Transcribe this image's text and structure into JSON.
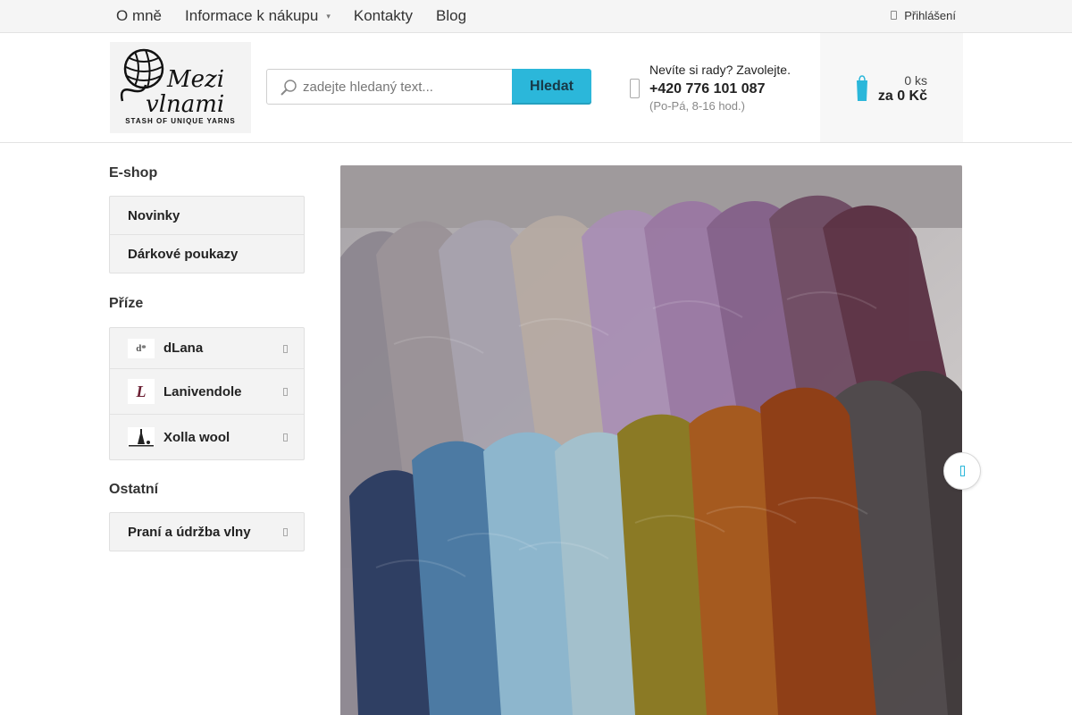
{
  "topnav": {
    "items": [
      {
        "label": "O mně"
      },
      {
        "label": "Informace k nákupu",
        "has_dropdown": true
      },
      {
        "label": "Kontakty"
      },
      {
        "label": "Blog"
      }
    ],
    "login_label": "Přihlášení"
  },
  "header": {
    "logo": {
      "text": "Mezi vlnami",
      "tagline": "STASH OF UNIQUE YARNS",
      "icon": "yarn-ball-logo"
    },
    "search": {
      "placeholder": "zadejte hledaný text...",
      "value": "",
      "button_label": "Hledat"
    },
    "contact": {
      "question": "Nevíte si rady? Zavolejte.",
      "phone": "+420 776 101 087",
      "hours": "(Po-Pá, 8-16 hod.)"
    },
    "cart": {
      "quantity": "0 ks",
      "total": "za 0 Kč"
    }
  },
  "sidebar": {
    "sections": [
      {
        "title": "E-shop",
        "items": [
          {
            "label": "Novinky"
          },
          {
            "label": "Dárkové poukazy"
          }
        ]
      },
      {
        "title": "Příze",
        "items": [
          {
            "label": "dLana",
            "thumb_text": "d*"
          },
          {
            "label": "Lanivendole",
            "thumb_text": "L"
          },
          {
            "label": "Xolla wool",
            "thumb_icon": "xolla-logo"
          }
        ]
      },
      {
        "title": "Ostatní",
        "items": [
          {
            "label": "Praní a údržba vlny"
          }
        ]
      }
    ]
  },
  "colors": {
    "accent": "#2bb7da",
    "cart_icon": "#2bb7da",
    "topbar_bg": "#f5f5f5"
  },
  "hero": {
    "image": "yarn skeins photo"
  }
}
